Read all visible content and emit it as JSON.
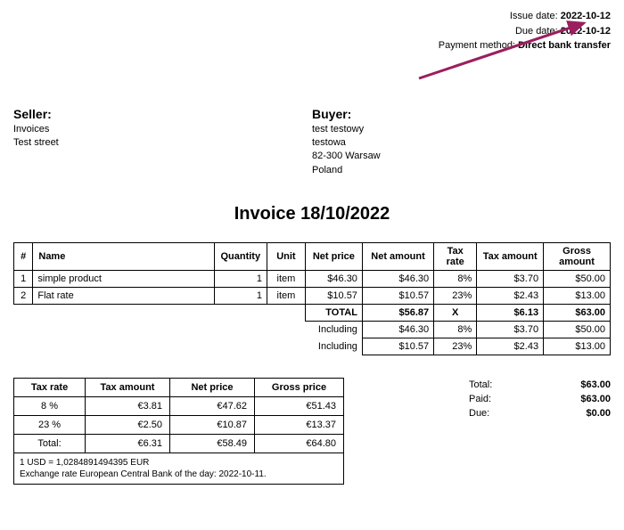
{
  "meta": {
    "issue_label": "Issue date:",
    "issue_value": "2022-10-12",
    "due_label": "Due date:",
    "due_value": "2022-10-12",
    "payment_label": "Payment method:",
    "payment_value": "Direct bank transfer"
  },
  "seller": {
    "title": "Seller:",
    "line1": "Invoices",
    "line2": "Test street"
  },
  "buyer": {
    "title": "Buyer:",
    "line1": "test testowy",
    "line2": "testowa",
    "line3": "82-300 Warsaw",
    "line4": "Poland"
  },
  "invoice_title": "Invoice 18/10/2022",
  "headers": {
    "num": "#",
    "name": "Name",
    "qty": "Quantity",
    "unit": "Unit",
    "net_price": "Net price",
    "net_amount": "Net amount",
    "tax_rate": "Tax rate",
    "tax_amount": "Tax amount",
    "gross_amount": "Gross amount"
  },
  "rows": [
    {
      "num": "1",
      "name": "simple product",
      "qty": "1",
      "unit": "item",
      "net_price": "$46.30",
      "net_amount": "$46.30",
      "tax_rate": "8%",
      "tax_amount": "$3.70",
      "gross_amount": "$50.00"
    },
    {
      "num": "2",
      "name": "Flat rate",
      "qty": "1",
      "unit": "item",
      "net_price": "$10.57",
      "net_amount": "$10.57",
      "tax_rate": "23%",
      "tax_amount": "$2.43",
      "gross_amount": "$13.00"
    }
  ],
  "totals": {
    "total_label": "TOTAL",
    "total_net": "$56.87",
    "total_rate": "X",
    "total_tax": "$6.13",
    "total_gross": "$63.00",
    "inc_label": "Including",
    "inc1_net": "$46.30",
    "inc1_rate": "8%",
    "inc1_tax": "$3.70",
    "inc1_gross": "$50.00",
    "inc2_net": "$10.57",
    "inc2_rate": "23%",
    "inc2_tax": "$2.43",
    "inc2_gross": "$13.00"
  },
  "tax_headers": {
    "rate": "Tax rate",
    "amount": "Tax amount",
    "net": "Net price",
    "gross": "Gross price"
  },
  "tax_rows": [
    {
      "rate": "8 %",
      "amount": "€3.81",
      "net": "€47.62",
      "gross": "€51.43"
    },
    {
      "rate": "23 %",
      "amount": "€2.50",
      "net": "€10.87",
      "gross": "€13.37"
    },
    {
      "rate": "Total:",
      "amount": "€6.31",
      "net": "€58.49",
      "gross": "€64.80"
    }
  ],
  "exchange": {
    "line1": "1 USD = 1,0284891494395 EUR",
    "line2": "Exchange rate European Central Bank of the day: 2022-10-11."
  },
  "summary": {
    "total_label": "Total:",
    "total_value": "$63.00",
    "paid_label": "Paid:",
    "paid_value": "$63.00",
    "due_label": "Due:",
    "due_value": "$0.00"
  }
}
